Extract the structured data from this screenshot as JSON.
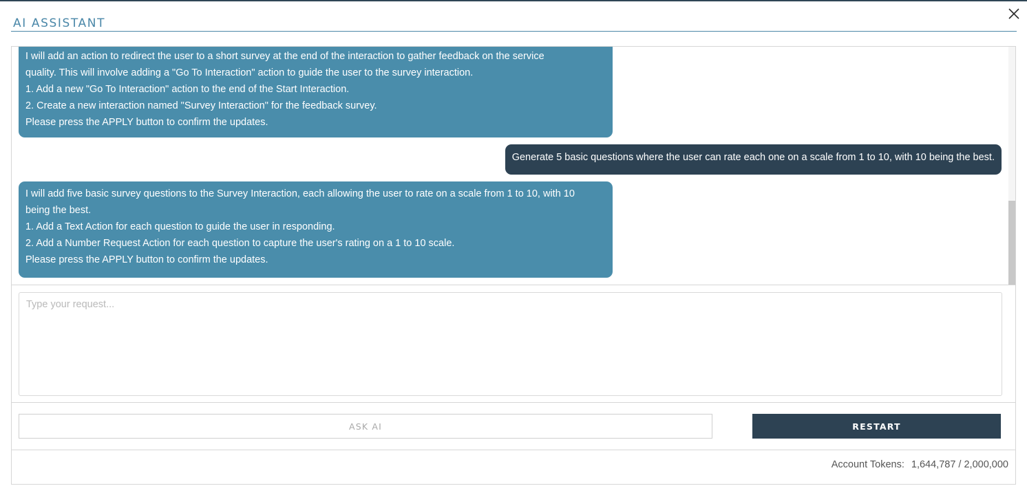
{
  "dialog": {
    "title": "AI ASSISTANT",
    "close_icon": "close-icon"
  },
  "chat": {
    "messages": [
      {
        "role": "assistant",
        "lines": [
          "I will add an action to redirect the user to a short survey at the end of the interaction to gather feedback on the service",
          "quality. This will involve adding a \"Go To Interaction\" action to guide the user to the survey interaction.",
          "1. Add a new \"Go To Interaction\" action to the end of the Start Interaction.",
          "2. Create a new interaction named \"Survey Interaction\" for the feedback survey.",
          "Please press the APPLY button to confirm the updates."
        ]
      },
      {
        "role": "user",
        "text": "Generate 5 basic questions where the user can rate each one on a scale from 1 to 10, with 10 being the best."
      },
      {
        "role": "assistant",
        "lines": [
          "I will add five basic survey questions to the Survey Interaction, each allowing the user to rate on a scale from 1 to 10, with 10",
          "being the best.",
          "1. Add a Text Action for each question to guide the user in responding.",
          "2. Add a Number Request Action for each question to capture the user's rating on a 1 to 10 scale.",
          "Please press the APPLY button to confirm the updates."
        ]
      }
    ]
  },
  "input": {
    "placeholder": "Type your request...",
    "value": ""
  },
  "actions": {
    "ask_label": "ASK AI",
    "restart_label": "RESTART"
  },
  "footer": {
    "tokens_label": "Account Tokens:",
    "tokens_value": "1,644,787 / 2,000,000"
  },
  "colors": {
    "accent": "#4a87a8",
    "assistant_bubble": "#4a8dab",
    "user_bubble": "#2d4253",
    "restart_button": "#2d4253"
  }
}
